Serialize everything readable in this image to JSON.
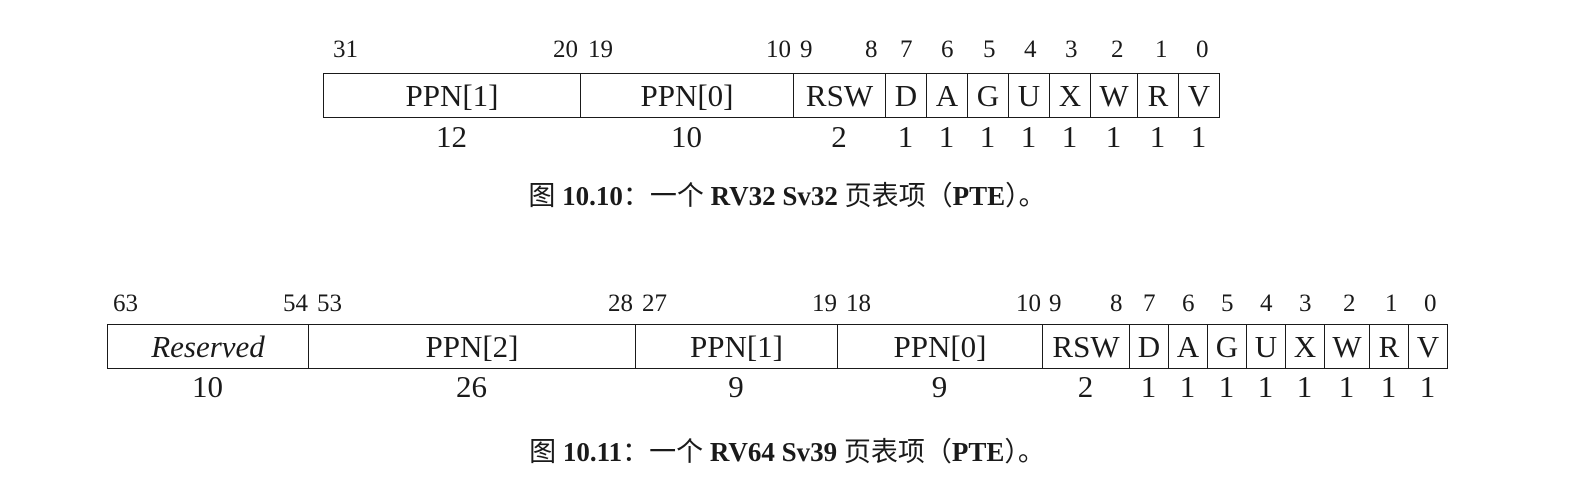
{
  "figure1": {
    "bit_labels": [
      "31",
      "20",
      "19",
      "10",
      "9",
      "8",
      "7",
      "6",
      "5",
      "4",
      "3",
      "2",
      "1",
      "0"
    ],
    "fields": [
      {
        "name": "PPN[1]",
        "width": "12"
      },
      {
        "name": "PPN[0]",
        "width": "10"
      },
      {
        "name": "RSW",
        "width": "2"
      },
      {
        "name": "D",
        "width": "1"
      },
      {
        "name": "A",
        "width": "1"
      },
      {
        "name": "G",
        "width": "1"
      },
      {
        "name": "U",
        "width": "1"
      },
      {
        "name": "X",
        "width": "1"
      },
      {
        "name": "W",
        "width": "1"
      },
      {
        "name": "R",
        "width": "1"
      },
      {
        "name": "V",
        "width": "1"
      }
    ],
    "caption_prefix": "图 ",
    "caption_num": "10.10",
    "caption_mid": "：一个 ",
    "caption_bold": "RV32 Sv32",
    "caption_mid2": " 页表项（",
    "caption_pte": "PTE",
    "caption_end": "）。"
  },
  "figure2": {
    "bit_labels": [
      "63",
      "54",
      "53",
      "28",
      "27",
      "19",
      "18",
      "10",
      "9",
      "8",
      "7",
      "6",
      "5",
      "4",
      "3",
      "2",
      "1",
      "0"
    ],
    "fields": [
      {
        "name": "Reserved",
        "width": "10"
      },
      {
        "name": "PPN[2]",
        "width": "26"
      },
      {
        "name": "PPN[1]",
        "width": "9"
      },
      {
        "name": "PPN[0]",
        "width": "9"
      },
      {
        "name": "RSW",
        "width": "2"
      },
      {
        "name": "D",
        "width": "1"
      },
      {
        "name": "A",
        "width": "1"
      },
      {
        "name": "G",
        "width": "1"
      },
      {
        "name": "U",
        "width": "1"
      },
      {
        "name": "X",
        "width": "1"
      },
      {
        "name": "W",
        "width": "1"
      },
      {
        "name": "R",
        "width": "1"
      },
      {
        "name": "V",
        "width": "1"
      }
    ],
    "caption_prefix": "图 ",
    "caption_num": "10.11",
    "caption_mid": "：一个 ",
    "caption_bold": "RV64 Sv39",
    "caption_mid2": " 页表项（",
    "caption_pte": "PTE",
    "caption_end": "）。"
  }
}
